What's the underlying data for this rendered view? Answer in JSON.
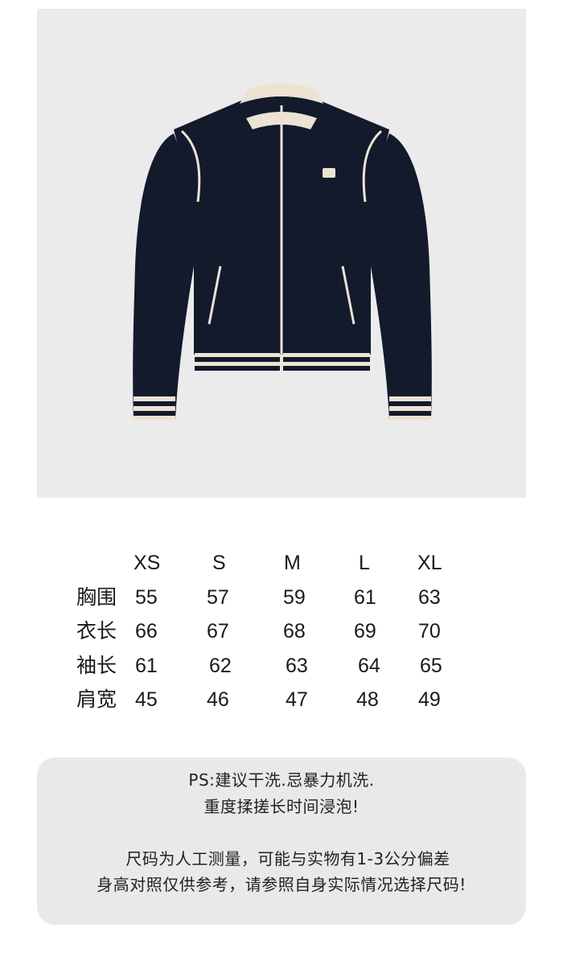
{
  "product_image": {
    "alt_icon": "jacket-image",
    "colors": {
      "background": "#ebebeb",
      "jacket_body": "#121a2c",
      "trim_cream": "#ece3d2",
      "trim_navy": "#121a2c"
    }
  },
  "size_chart": {
    "sizes": [
      "XS",
      "S",
      "M",
      "L",
      "XL"
    ],
    "rows": [
      {
        "label": "胸围",
        "values": [
          "55",
          "57",
          "59",
          "61",
          "63"
        ]
      },
      {
        "label": "衣长",
        "values": [
          "66",
          "67",
          "68",
          "69",
          "70"
        ]
      },
      {
        "label": "袖长",
        "values": [
          "61",
          "62",
          "63",
          "64",
          "65"
        ]
      },
      {
        "label": "肩宽",
        "values": [
          "45",
          "46",
          "47",
          "48",
          "49"
        ]
      }
    ]
  },
  "notes": {
    "line1": "PS:建议干洗.忌暴力机洗.",
    "line2": "重度揉搓长时间浸泡!",
    "line3": "尺码为人工测量，可能与实物有1-3公分偏差",
    "line4": "身高对照仅供参考，请参照自身实际情况选择尺码!"
  }
}
